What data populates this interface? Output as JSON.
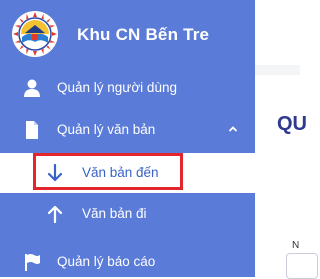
{
  "brand": {
    "name": "Khu CN Bến Tre"
  },
  "nav": {
    "users": {
      "label": "Quản lý người dùng"
    },
    "documents": {
      "label": "Quản lý văn bản",
      "sub": [
        {
          "label": "Văn bản đến",
          "active": true
        },
        {
          "label": "Văn bản đi",
          "active": false
        }
      ]
    },
    "reports": {
      "label": "Quản lý báo cáo"
    }
  },
  "main": {
    "title_partial": "QU",
    "field_label_partial": "N"
  },
  "colors": {
    "sidebar": "#5a7bd8",
    "active_text": "#3a63c8",
    "highlight": "#e3262e",
    "title": "#2f3a8f"
  }
}
